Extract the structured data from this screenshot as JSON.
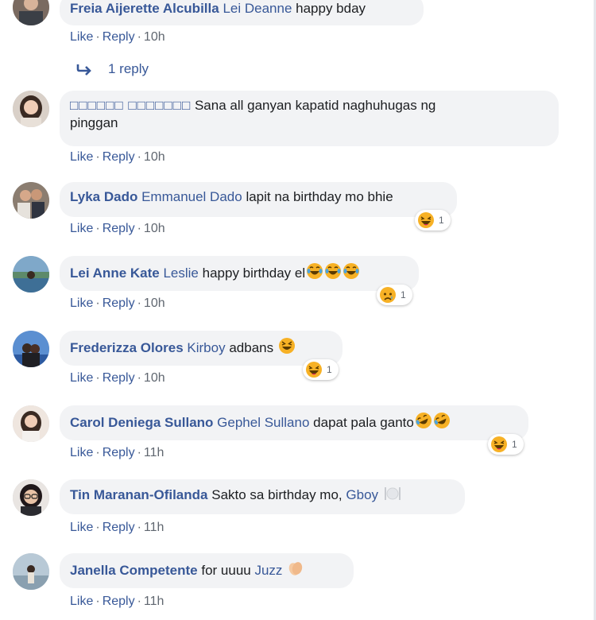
{
  "comments": [
    {
      "author": "Freia Aijerette Alcubilla",
      "mention": "Lei Deanne",
      "text": "happy bday",
      "like": "Like",
      "reply": "Reply",
      "time": "10h",
      "reply_thread": {
        "label": "1 reply"
      }
    },
    {
      "author": "□□□□□□ □□□□□□□",
      "text_line1": "Sana all ganyan kapatid naghuhugas ng",
      "text_line2": "pinggan",
      "like": "Like",
      "reply": "Reply",
      "time": "10h"
    },
    {
      "author": "Lyka Dado",
      "mention": "Emmanuel Dado",
      "text": "lapit na birthday mo bhie",
      "like": "Like",
      "reply": "Reply",
      "time": "10h",
      "reaction": {
        "icon": "haha-icon",
        "count": "1"
      }
    },
    {
      "author": "Lei Anne Kate",
      "mention": "Leslie",
      "text": "happy birthday el",
      "emojis": [
        "joy-emoji",
        "joy-emoji",
        "joy-emoji"
      ],
      "like": "Like",
      "reply": "Reply",
      "time": "10h",
      "reaction": {
        "icon": "sad-icon",
        "count": "1"
      }
    },
    {
      "author": "Frederizza Olores",
      "mention": "Kirboy",
      "text": "adbans",
      "emojis": [
        "squint-laugh-emoji"
      ],
      "like": "Like",
      "reply": "Reply",
      "time": "10h",
      "reaction": {
        "icon": "haha-icon",
        "count": "1"
      }
    },
    {
      "author": "Carol Deniega Sullano",
      "mention": "Gephel Sullano",
      "text": "dapat pala ganto",
      "emojis": [
        "rofl-emoji",
        "rofl-emoji"
      ],
      "like": "Like",
      "reply": "Reply",
      "time": "11h",
      "reaction": {
        "icon": "haha-icon",
        "count": "1"
      }
    },
    {
      "author": "Tin Maranan-Ofilanda",
      "text": "Sakto sa birthday mo,",
      "mention": "Gboy",
      "emojis": [
        "fork-knife-plate-emoji"
      ],
      "like": "Like",
      "reply": "Reply",
      "time": "11h"
    },
    {
      "author": "Janella Competente",
      "text": "for uuuu",
      "mention": "Juzz",
      "emojis": [
        "clapping-hands-emoji"
      ],
      "like": "Like",
      "reply": "Reply",
      "time": "11h"
    }
  ],
  "colors": {
    "link": "#385898",
    "bubble": "#f2f3f5",
    "meta": "#606770",
    "haha_yellow": "#f7b125",
    "haha_red": "#e0245e"
  }
}
